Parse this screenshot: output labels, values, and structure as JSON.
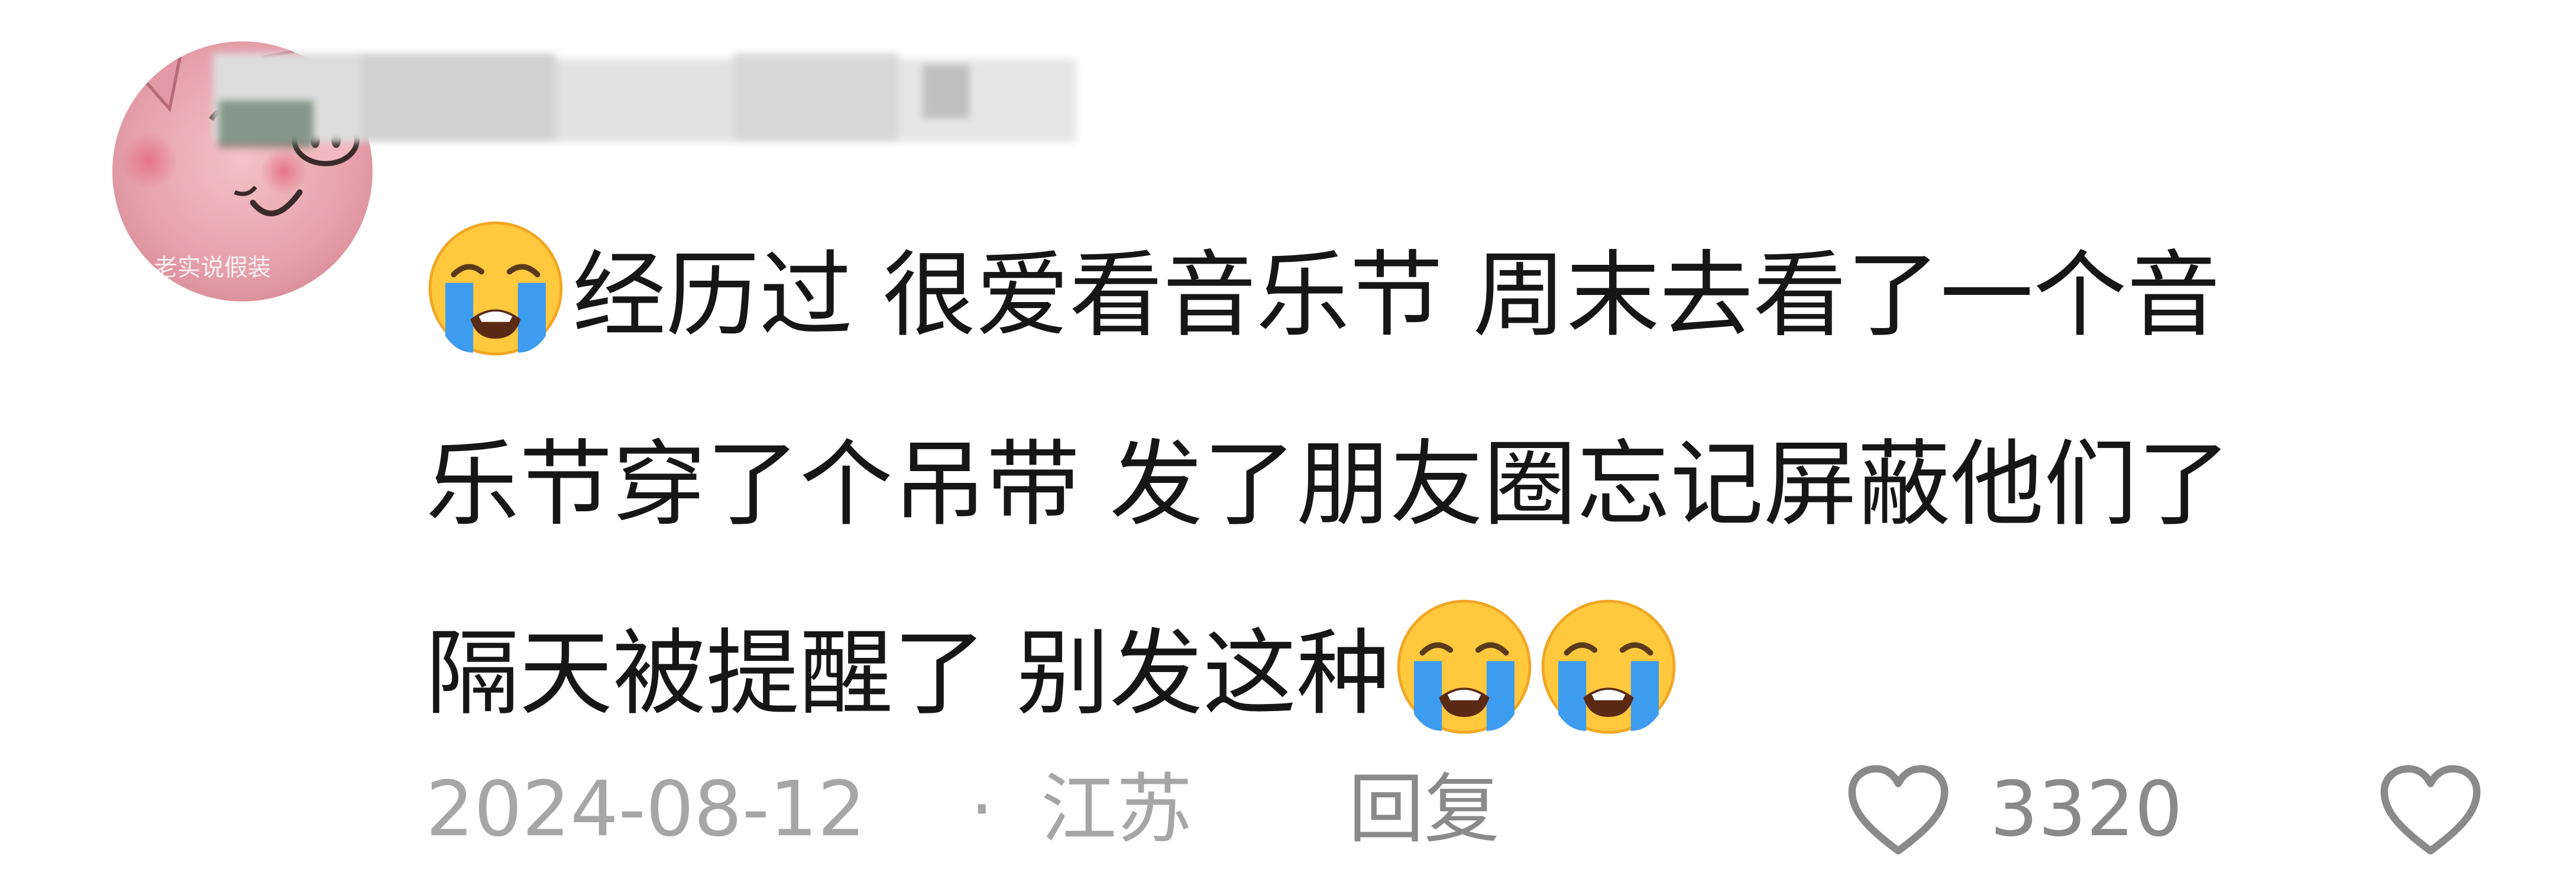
{
  "comment": {
    "username": "",
    "avatar_text": "老实说假装",
    "body_lines": [
      "经历过 很爱看音乐节 周末去看了一个音",
      "乐节穿了个吊带 发了朋友圈忘记屏蔽他们了",
      "隔天被提醒了 别发这种"
    ],
    "emoji_icon": "loudly-crying-face-icon",
    "date": "2024-08-12",
    "separator": "·",
    "location": "江苏",
    "reply_label": "回复",
    "like_count": "3320",
    "colors": {
      "text": "#161616",
      "meta": "#a6a6a6",
      "avatar_bg": "#e9a7b0",
      "emoji_yellow": "#ffc83d",
      "tear_blue": "#3d9cf0"
    }
  }
}
